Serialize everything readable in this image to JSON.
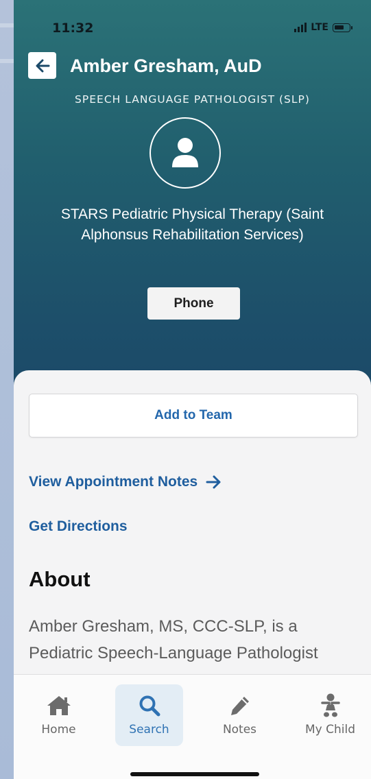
{
  "status": {
    "time": "11:32",
    "network": "LTE"
  },
  "provider": {
    "name": "Amber Gresham, AuD",
    "role": "SPEECH LANGUAGE PATHOLOGIST (SLP)",
    "organization": "STARS Pediatric Physical Therapy (Saint Alphonsus Rehabilitation Services)"
  },
  "actions": {
    "phone_label": "Phone",
    "add_team_label": "Add to Team",
    "view_notes_label": "View Appointment Notes",
    "directions_label": "Get Directions"
  },
  "about": {
    "heading": "About",
    "text": "Amber Gresham, MS, CCC-SLP, is a Pediatric Speech-Language Pathologist"
  },
  "tabs": [
    {
      "label": "Home",
      "icon": "home-icon",
      "active": false
    },
    {
      "label": "Search",
      "icon": "search-icon",
      "active": true
    },
    {
      "label": "Notes",
      "icon": "pencil-icon",
      "active": false
    },
    {
      "label": "My Child",
      "icon": "baby-icon",
      "active": false
    }
  ],
  "colors": {
    "header_top": "#2b7277",
    "header_bottom": "#1b4968",
    "link": "#1f5e9e",
    "active_tab": "#2f72b3"
  }
}
